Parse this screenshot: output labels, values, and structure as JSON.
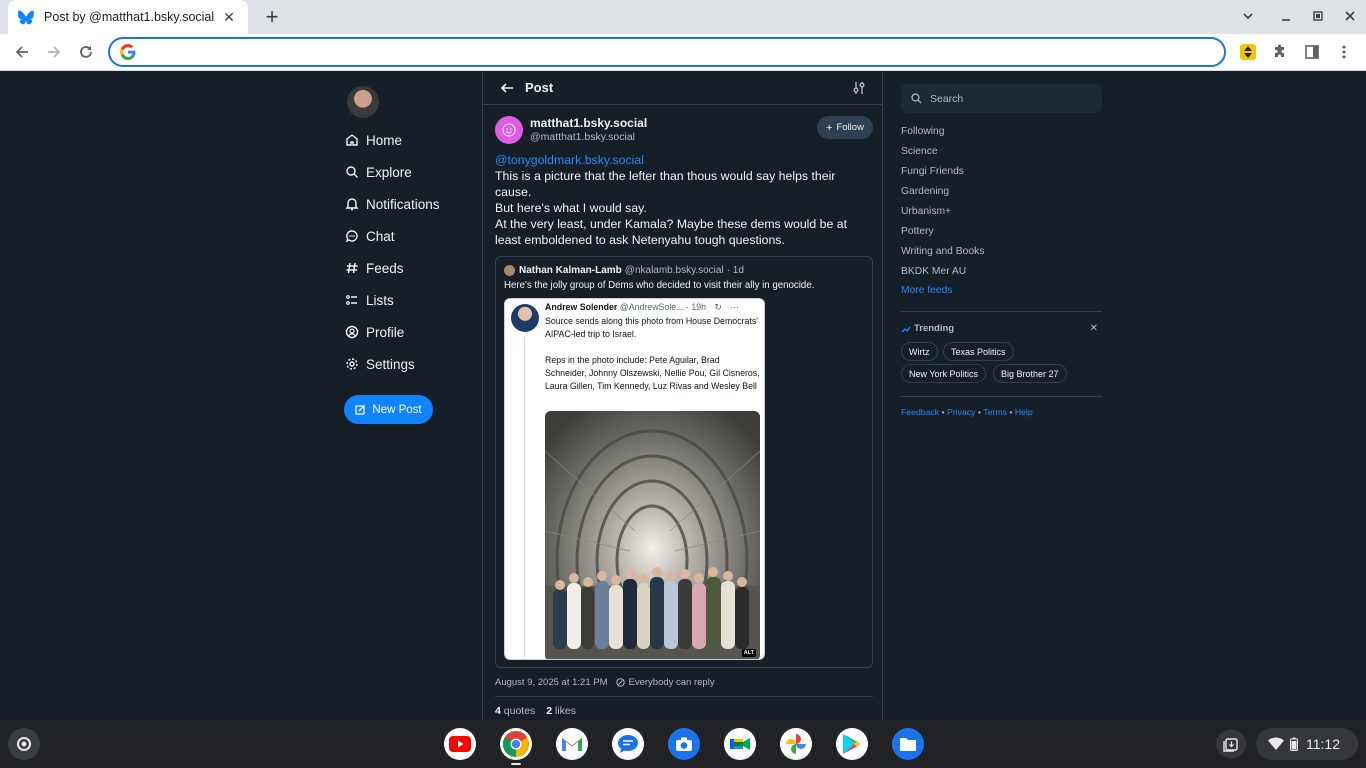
{
  "browser": {
    "tab_title": "Post by @matthat1.bsky.social",
    "omnibox_value": "",
    "omnibox_placeholder": ""
  },
  "nav": {
    "items": [
      {
        "label": "Home",
        "icon": "home-icon"
      },
      {
        "label": "Explore",
        "icon": "search-icon"
      },
      {
        "label": "Notifications",
        "icon": "bell-icon"
      },
      {
        "label": "Chat",
        "icon": "chat-icon"
      },
      {
        "label": "Feeds",
        "icon": "hash-icon"
      },
      {
        "label": "Lists",
        "icon": "list-icon"
      },
      {
        "label": "Profile",
        "icon": "profile-icon"
      },
      {
        "label": "Settings",
        "icon": "gear-icon"
      }
    ],
    "new_post_label": "New Post"
  },
  "post": {
    "header_title": "Post",
    "author_name": "matthat1.bsky.social",
    "author_handle": "@matthat1.bsky.social",
    "follow_label": "Follow",
    "mention": "@tonygoldmark.bsky.social",
    "lines": [
      "This is a picture that the lefter than thous would say helps their cause.",
      "But here's what I would say.",
      "At the very least, under Kamala? Maybe these dems would be at least emboldened to ask Netenyahu tough questions."
    ],
    "timestamp": "August 9, 2025 at 1:21 PM",
    "reply_setting": "Everybody can reply",
    "quotes_count": "4",
    "quotes_label": "quotes",
    "likes_count": "2",
    "likes_label": "likes"
  },
  "quote": {
    "author_name": "Nathan Kalman-Lamb",
    "author_handle": "@nkalamb.bsky.social",
    "age": "· 1d",
    "text": "Here's the jolly group of Dems who decided to visit their ally in genocide.",
    "tweet": {
      "name": "Andrew Solender",
      "handle": "@AndrewSole...",
      "age": "· 19h",
      "para1": "Source sends along this photo from House Democrats' AIPAC-led trip to Israel.",
      "para2": "Reps in the photo include: Pete Aguilar, Brad Schneider, Johnny Olszewski, Nellie Pou, Gil Cisneros, Laura Gillen, Tim Kennedy, Luz Rivas and Wesley Bell",
      "alt": "ALT"
    }
  },
  "sidebar": {
    "search_placeholder": "Search",
    "feeds": [
      "Following",
      "Science",
      "Fungi Friends",
      "Gardening",
      "Urbanism+",
      "Pottery",
      "Writing and Books",
      "BKDK Mer AU"
    ],
    "more_feeds": "More feeds",
    "trending_title": "Trending",
    "trending": [
      "Wirtz",
      "Texas Politics",
      "New York Politics",
      "Big Brother 27"
    ],
    "footer": [
      "Feedback",
      "Privacy",
      "Terms",
      "Help"
    ],
    "footer_sep": "•"
  },
  "shelf": {
    "apps": [
      "youtube-icon",
      "chrome-icon",
      "gmail-icon",
      "messages-icon",
      "camera-icon",
      "meet-icon",
      "photos-icon",
      "play-store-icon",
      "files-icon"
    ],
    "clock": "11:12"
  },
  "colors": {
    "accent": "#1083fe",
    "background": "#161e27",
    "border": "#2e4052",
    "link": "#208bfe"
  }
}
